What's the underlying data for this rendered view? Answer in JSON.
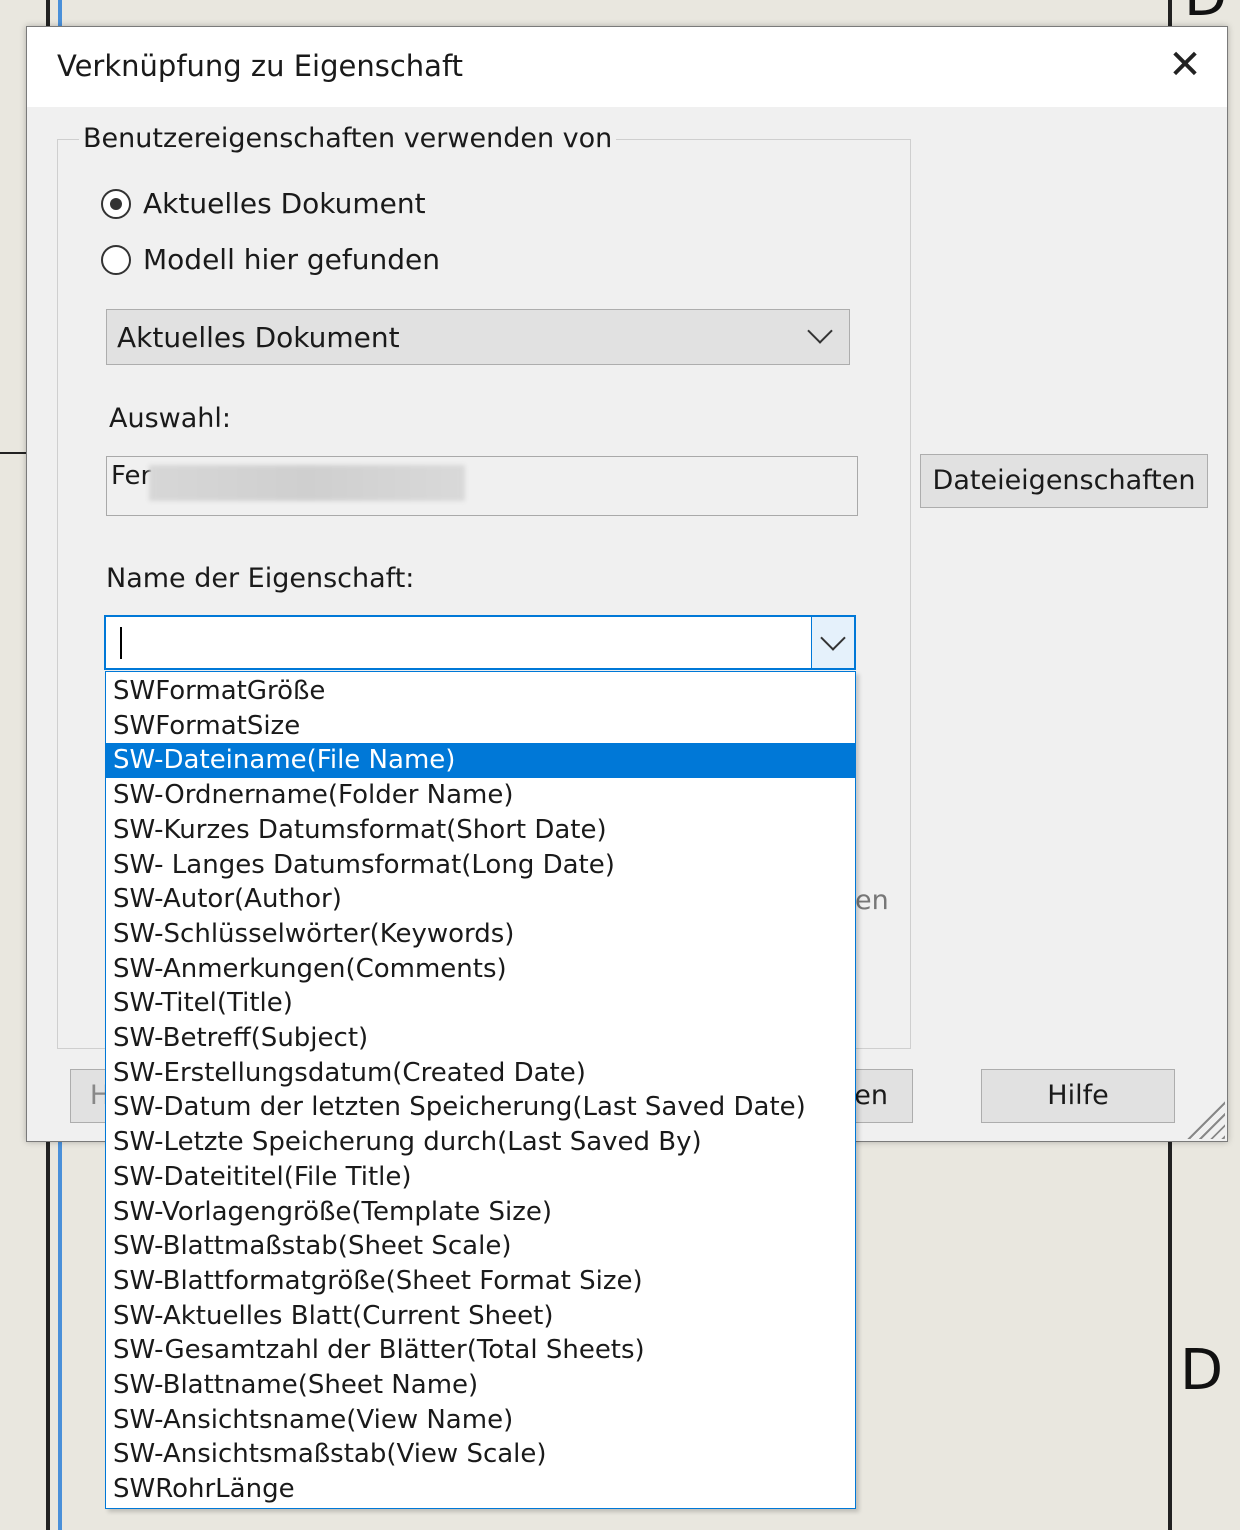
{
  "dialog": {
    "title": "Verknüpfung zu Eigenschaft",
    "close_glyph": "✕",
    "group_label": "Benutzereigenschaften verwenden von",
    "radio_current_label": "Aktuelles Dokument",
    "radio_model_label": "Modell hier gefunden",
    "source_combo_value": "Aktuelles Dokument",
    "selection_label": "Auswahl:",
    "selection_value": "Fer",
    "file_properties_button": "Dateieigenschaften",
    "property_name_label": "Name der Eigenschaft:",
    "property_name_value": "",
    "help_button": "Hilfe",
    "partial_left_button": "H",
    "partial_mid_button": "en",
    "partial_hidden_text": "en"
  },
  "dropdown": {
    "selected_index": 2,
    "items": [
      "SWFormatGröße",
      "SWFormatSize",
      "SW-Dateiname(File Name)",
      "SW-Ordnername(Folder Name)",
      "SW-Kurzes Datumsformat(Short Date)",
      "SW- Langes Datumsformat(Long Date)",
      "SW-Autor(Author)",
      "SW-Schlüsselwörter(Keywords)",
      "SW-Anmerkungen(Comments)",
      "SW-Titel(Title)",
      "SW-Betreff(Subject)",
      "SW-Erstellungsdatum(Created Date)",
      "SW-Datum der letzten Speicherung(Last Saved Date)",
      "SW-Letzte Speicherung durch(Last Saved By)",
      "SW-Dateititel(File Title)",
      "SW-Vorlagengröße(Template Size)",
      "SW-Blattmaßstab(Sheet Scale)",
      "SW-Blattformatgröße(Sheet Format Size)",
      "SW-Aktuelles Blatt(Current Sheet)",
      "SW-Gesamtzahl der Blätter(Total Sheets)",
      "SW-Blattname(Sheet Name)",
      "SW-Ansichtsname(View Name)",
      "SW-Ansichtsmaßstab(View Scale)",
      "SWRohrLänge"
    ]
  },
  "background": {
    "letter_top": "D",
    "letter_bottom": "D"
  }
}
